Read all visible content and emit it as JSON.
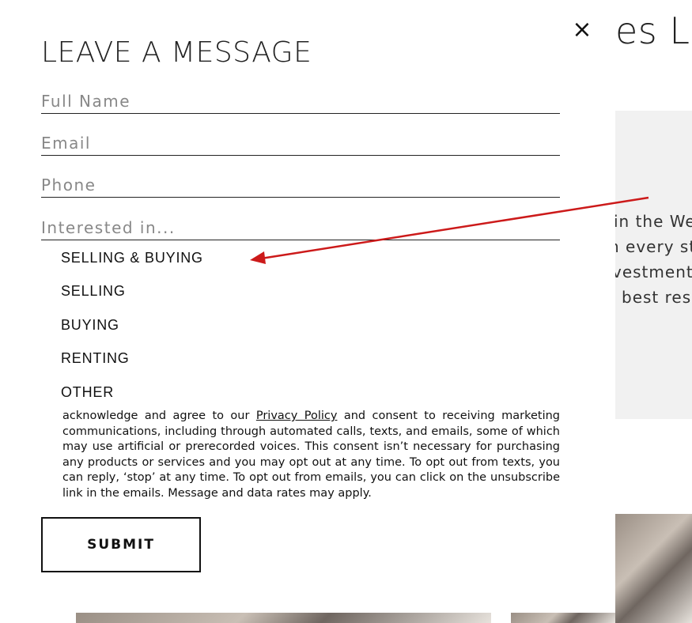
{
  "background": {
    "title_fragment": "es Lu",
    "text_lines": [
      "in the We",
      "n every st",
      "vestment",
      "best res"
    ]
  },
  "modal": {
    "title": "LEAVE A MESSAGE",
    "close_symbol": "×",
    "fields": {
      "full_name_placeholder": "Full Name",
      "email_placeholder": "Email",
      "phone_placeholder": "Phone",
      "interest_placeholder": "Interested in..."
    },
    "options": [
      "SELLING & BUYING",
      "SELLING",
      "BUYING",
      "RENTING",
      "OTHER"
    ],
    "consent": {
      "prefix": "acknowledge and agree to our ",
      "link": "Privacy Policy",
      "suffix": " and consent to receiving marketing communications, including through automated calls, texts, and emails, some of which may use artificial or prerecorded voices. This consent isn’t necessary for purchasing any products or services and you may opt out at any time. To opt out from texts, you can reply, ‘stop’ at any time. To opt out from emails, you can click on the unsubscribe link in the emails. Message and data rates may apply."
    },
    "submit_label": "SUBMIT"
  },
  "annotation": {
    "arrow_color": "#cc1a1a"
  }
}
